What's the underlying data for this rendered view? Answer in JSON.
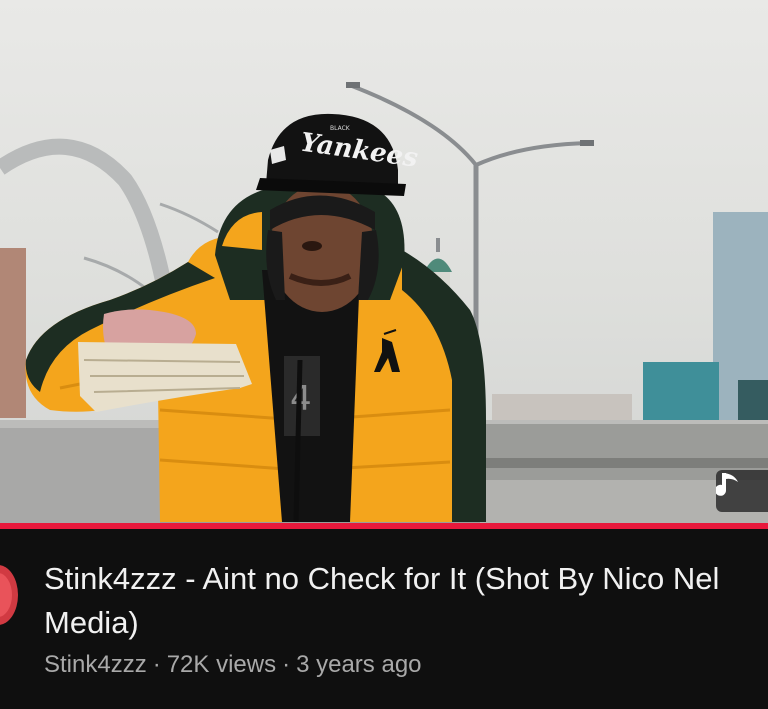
{
  "video": {
    "title": "Stink4zzz - Aint no Check for It (Shot By Nico Nel Media)",
    "channel": "Stink4zzz",
    "views": "72K views",
    "age": "3 years ago",
    "separator": "·",
    "progress_fraction": 1.0
  },
  "thumbnail": {
    "cap_text": "Yankees",
    "cap_small_text": "BLACK",
    "icons": {
      "overlay": "music-note-icon"
    }
  },
  "colors": {
    "progress": "#e8193c",
    "background": "#0f0f0f",
    "title": "#f1f1f1",
    "meta": "#a9a9a9",
    "jacket": "#f4a51c"
  }
}
